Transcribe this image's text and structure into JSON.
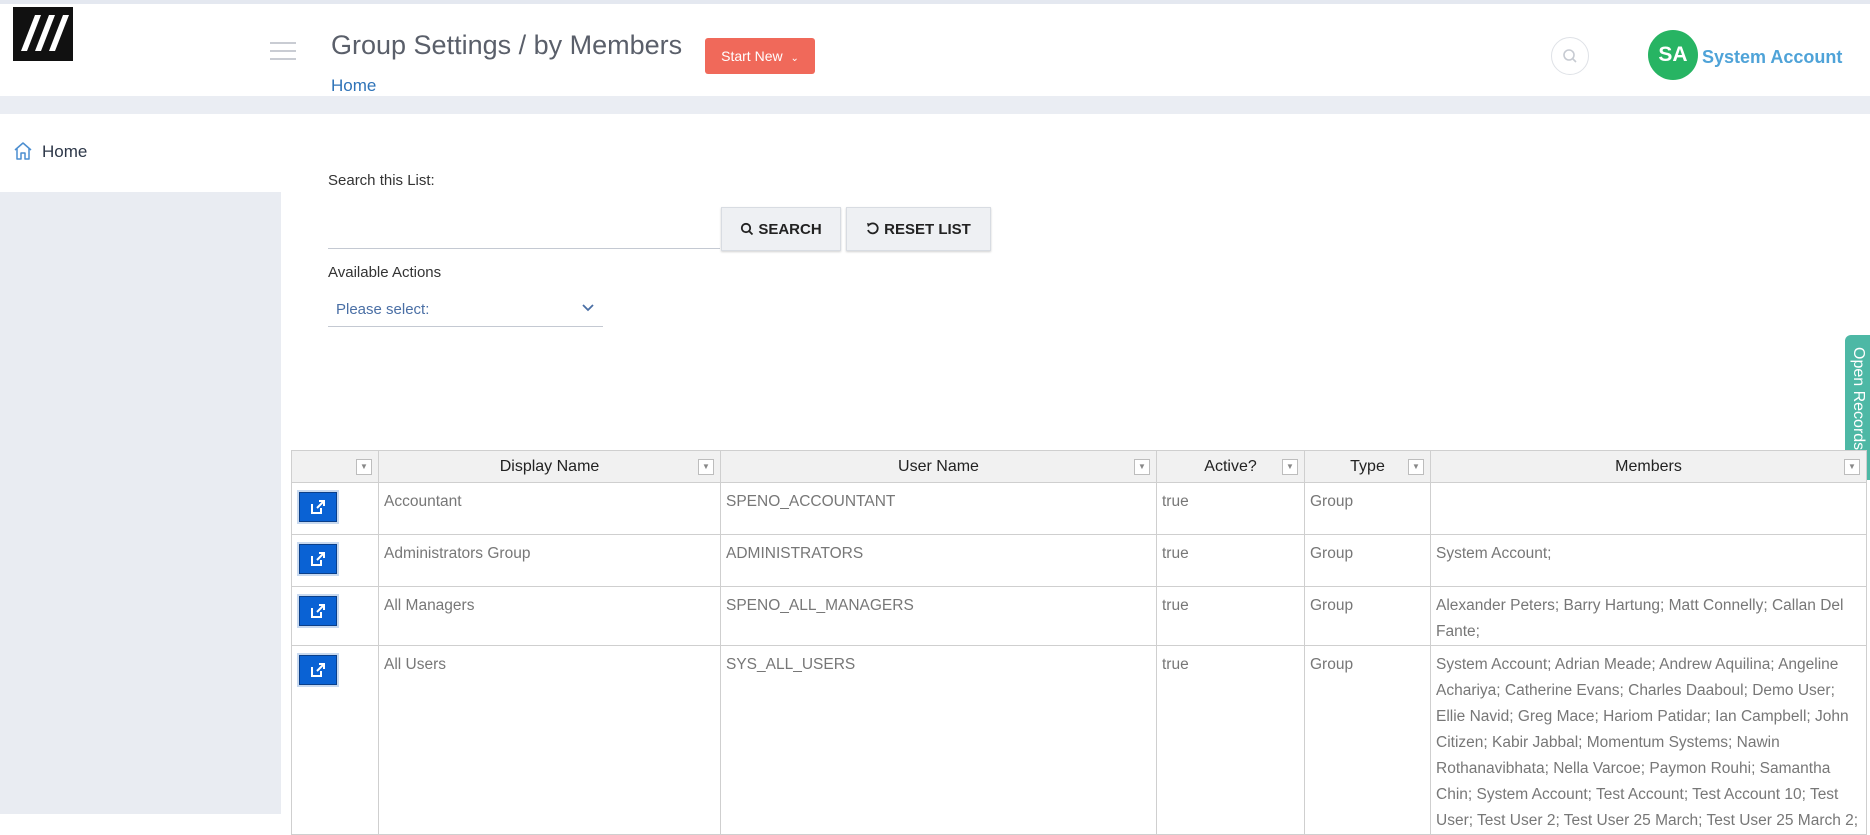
{
  "header": {
    "title": "Group Settings / by Members",
    "start_new_label": "Start New",
    "breadcrumb": "Home",
    "avatar_initials": "SA",
    "account_name": "System Account"
  },
  "sidebar": {
    "items": [
      {
        "label": "Home",
        "icon": "home-icon"
      }
    ]
  },
  "search": {
    "label": "Search this List:",
    "value": "",
    "search_button": "SEARCH",
    "reset_button": "RESET LIST"
  },
  "actions": {
    "label": "Available Actions",
    "selected": "Please select:"
  },
  "open_records_label": "Open Records",
  "table": {
    "headers": [
      "",
      "Display Name",
      "User Name",
      "Active?",
      "Type",
      "Members"
    ],
    "rows": [
      {
        "display_name": "Accountant",
        "user_name": "SPENO_ACCOUNTANT",
        "active": "true",
        "type": "Group",
        "members": ""
      },
      {
        "display_name": "Administrators Group",
        "user_name": "ADMINISTRATORS",
        "active": "true",
        "type": "Group",
        "members": "System Account;"
      },
      {
        "display_name": "All Managers",
        "user_name": "SPENO_ALL_MANAGERS",
        "active": "true",
        "type": "Group",
        "members": "Alexander Peters; Barry Hartung; Matt Connelly; Callan Del Fante;"
      },
      {
        "display_name": "All Users",
        "user_name": "SYS_ALL_USERS",
        "active": "true",
        "type": "Group",
        "members": "System Account; Adrian Meade; Andrew Aquilina; Angeline Achariya; Catherine Evans; Charles Daaboul; Demo User; Ellie Navid; Greg Mace; Hariom Patidar; Ian Campbell; John Citizen; Kabir Jabbal; Momentum Systems; Nawin Rothanavibhata; Nella Varcoe; Paymon Rouhi; Samantha Chin; System Account; Test Account; Test Account 10; Test User; Test User 2; Test User 25 March; Test User 25 March 2;"
      }
    ]
  },
  "colors": {
    "start_button": "#f0695a",
    "avatar": "#27b463",
    "link": "#2e73b8",
    "open_records_tab": "#4db8a5",
    "edit_button": "#0a62d4"
  }
}
